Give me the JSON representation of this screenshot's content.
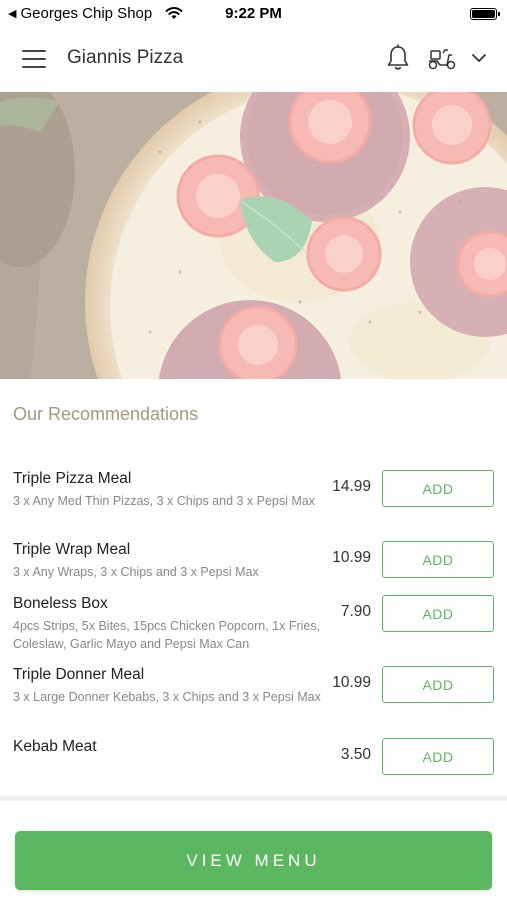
{
  "status_bar": {
    "back_label": "Georges Chip Shop",
    "time": "9:22 PM"
  },
  "header": {
    "title": "Giannis Pizza",
    "icons": [
      "menu-icon",
      "bell-icon",
      "scooter-icon",
      "chevron-down-icon"
    ]
  },
  "hero": {
    "image": "pepperoni-pizza-photo"
  },
  "recommendations": {
    "title": "Our Recommendations",
    "items": [
      {
        "name": "Triple Pizza Meal",
        "description": "3 x Any Med Thin Pizzas, 3 x Chips and 3 x Pepsi Max",
        "price": "14.99",
        "button_label": "ADD"
      },
      {
        "name": "Triple Wrap Meal",
        "description": "3 x Any Wraps, 3 x Chips and 3 x Pepsi Max",
        "price": "10.99",
        "button_label": "ADD"
      },
      {
        "name": "Boneless Box",
        "description": "4pcs Strips, 5x Bites, 15pcs Chicken Popcorn, 1x Fries, Coleslaw, Garlic Mayo and Pepsi Max Can",
        "price": "7.90",
        "button_label": "ADD"
      },
      {
        "name": "Triple Donner Meal",
        "description": "3 x Large Donner Kebabs, 3 x Chips and 3 x Pepsi Max",
        "price": "10.99",
        "button_label": "ADD"
      },
      {
        "name": "Kebab Meat",
        "description": "",
        "price": "3.50",
        "button_label": "ADD"
      }
    ]
  },
  "footer": {
    "view_menu_label": "VIEW MENU"
  },
  "colors": {
    "accent_green": "#5cb860",
    "section_title": "#a8987a"
  }
}
